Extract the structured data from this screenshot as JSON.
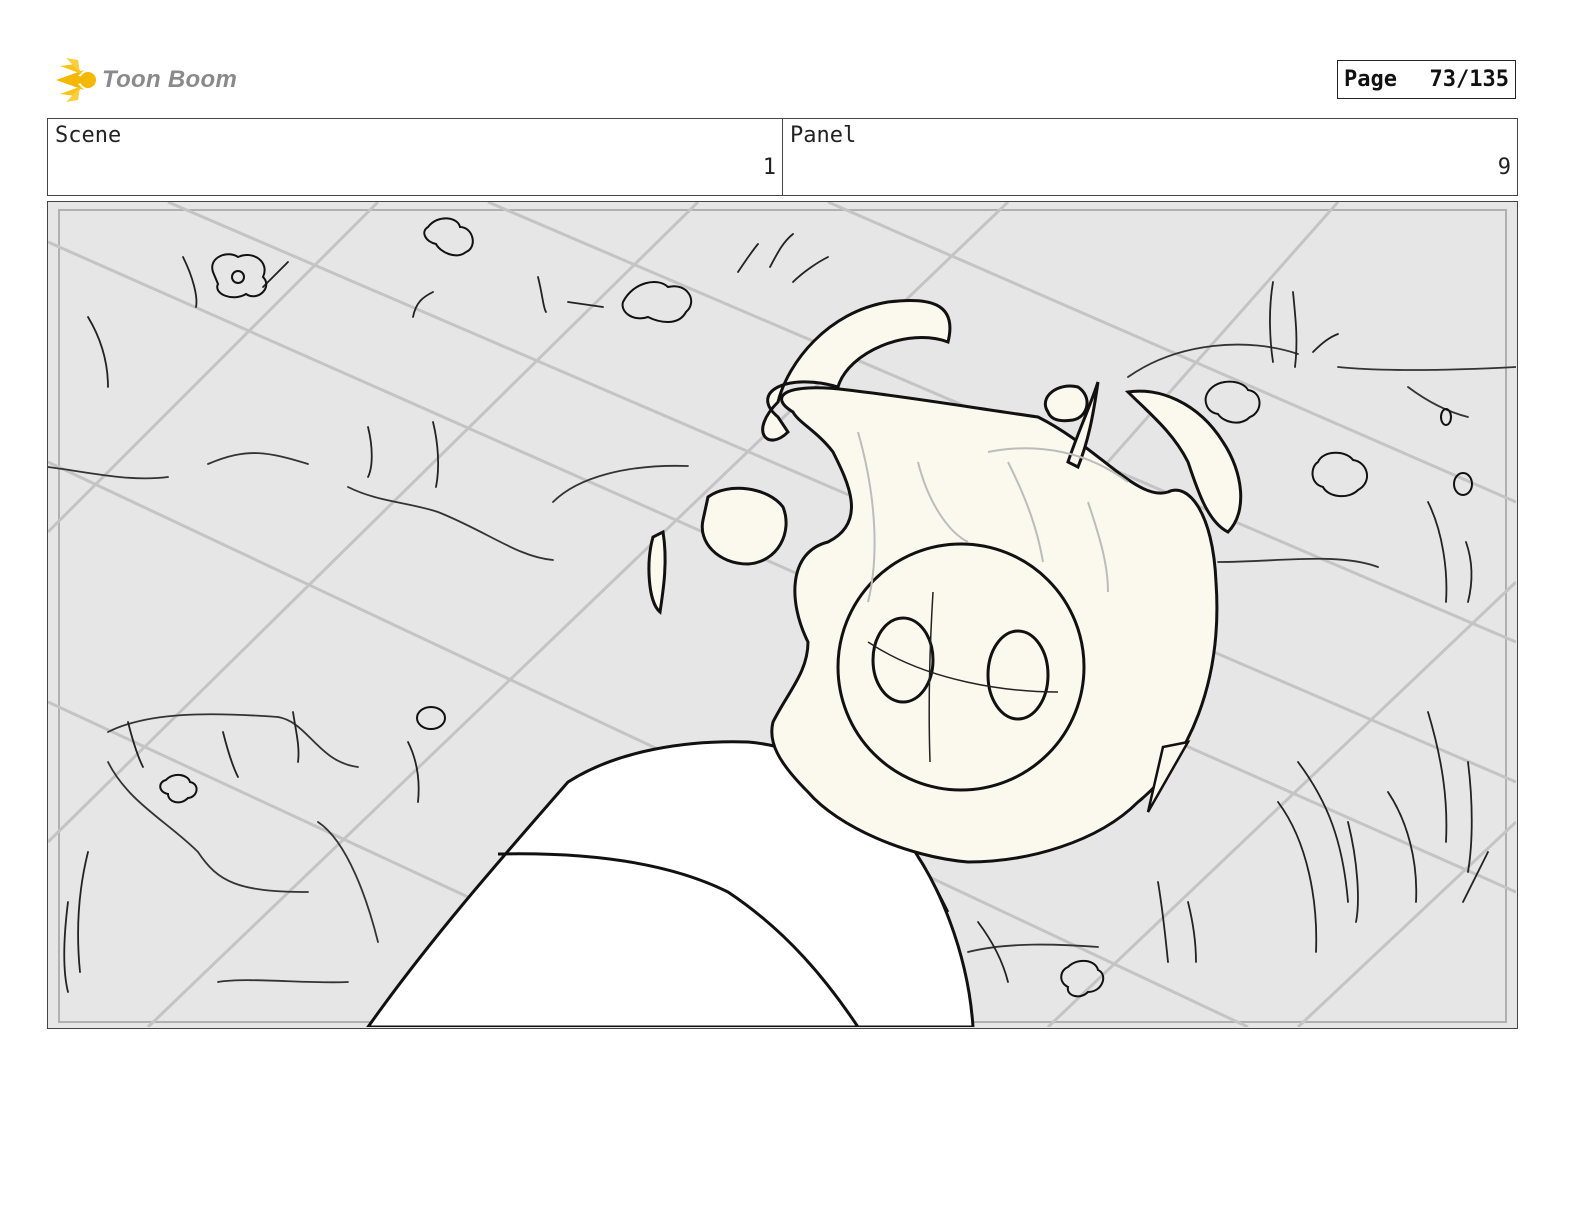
{
  "brand": {
    "logo_text": "Toon Boom",
    "logo_color": "#f5b800"
  },
  "page": {
    "label": "Page",
    "value": "73/135"
  },
  "header": {
    "scene_label": "Scene",
    "scene_value": "1",
    "panel_label": "Panel",
    "panel_value": "9"
  },
  "artwork": {
    "description_icon": "storyboard-sketch-icon",
    "ground_color": "#e6e6e6",
    "character_fill": "#fbf8ee",
    "line_color": "#111111"
  }
}
